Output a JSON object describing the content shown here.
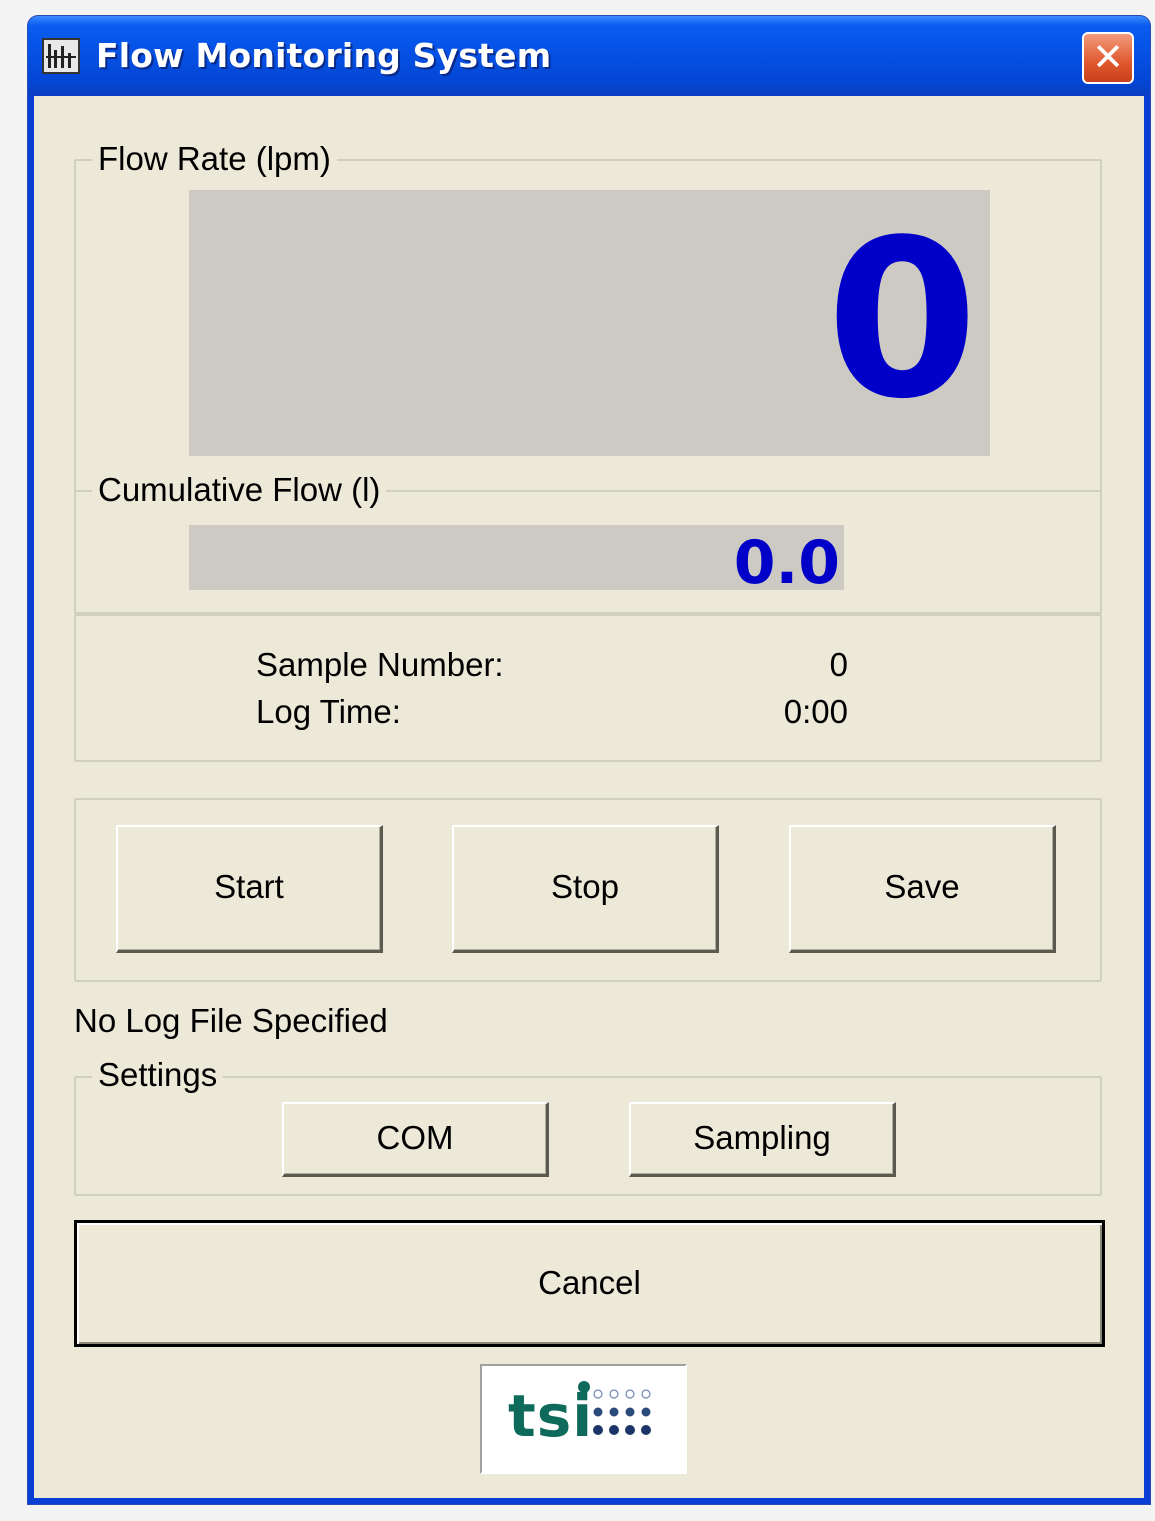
{
  "window": {
    "title": "Flow Monitoring System",
    "close_glyph": "✕"
  },
  "flow_rate": {
    "label": "Flow Rate (lpm)",
    "value": "0"
  },
  "cumulative_flow": {
    "label": "Cumulative Flow (l)",
    "value": "0.0"
  },
  "info": {
    "sample_number_label": "Sample Number:",
    "sample_number_value": "0",
    "log_time_label": "Log Time:",
    "log_time_value": "0:00"
  },
  "controls": {
    "start_label": "Start",
    "stop_label": "Stop",
    "save_label": "Save"
  },
  "status": {
    "log_file_text": "No Log File Specified"
  },
  "settings": {
    "label": "Settings",
    "com_label": "COM",
    "sampling_label": "Sampling"
  },
  "cancel_label": "Cancel",
  "logo": {
    "text": "tsi",
    "color": "#0e6a5a"
  },
  "colors": {
    "titlebar_blue": "#0653e6",
    "display_value_blue": "#0000c8",
    "display_background": "#cdc9c3",
    "dialog_background": "#ece9d8"
  }
}
